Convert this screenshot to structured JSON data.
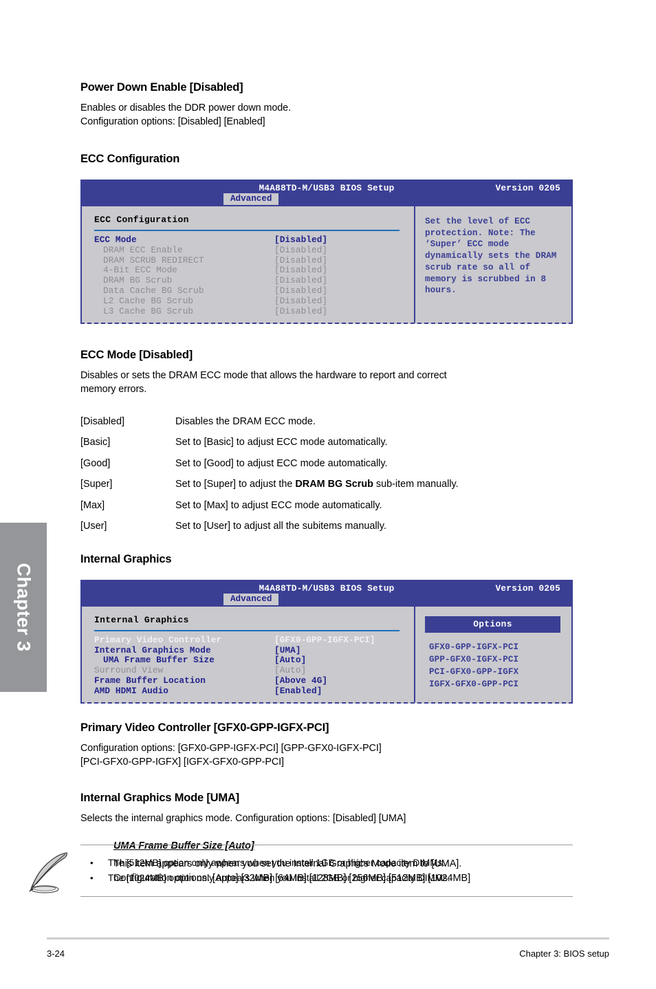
{
  "chapter_tab": {
    "label": "Chapter 3"
  },
  "sections": {
    "power_down": {
      "heading": "Power Down Enable [Disabled]",
      "line1": "Enables or disables the DDR power down mode.",
      "line2": "Configuration options: [Disabled] [Enabled]"
    },
    "ecc_config_heading": "ECC Configuration",
    "ecc_mode": {
      "heading": "ECC Mode [Disabled]",
      "desc_line1": "Disables or sets the DRAM ECC mode that allows the hardware to report and correct",
      "desc_line2": "memory errors.",
      "options": [
        {
          "key": "[Disabled]",
          "pre": "Disables the DRAM ECC mode.",
          "bold": "",
          "post": ""
        },
        {
          "key": "[Basic]",
          "pre": "Set to [Basic] to adjust ECC mode automatically.",
          "bold": "",
          "post": ""
        },
        {
          "key": "[Good]",
          "pre": "Set to [Good] to adjust ECC mode automatically.",
          "bold": "",
          "post": ""
        },
        {
          "key": "[Super]",
          "pre": "Set to [Super] to adjust the ",
          "bold": "DRAM BG Scrub",
          "post": " sub-item manually."
        },
        {
          "key": "[Max]",
          "pre": "Set to [Max] to adjust ECC mode automatically.",
          "bold": "",
          "post": ""
        },
        {
          "key": "[User]",
          "pre": "Set to [User] to adjust all the subitems manually.",
          "bold": "",
          "post": ""
        }
      ]
    },
    "internal_graphics_heading": "Internal Graphics",
    "primary_video": {
      "heading": "Primary Video Controller [GFX0-GPP-IGFX-PCI]",
      "line1": "Configuration options: [GFX0-GPP-IGFX-PCI] [GPP-GFX0-IGFX-PCI]",
      "line2": "[PCI-GFX0-GPP-IGFX] [IGFX-GFX0-GPP-PCI]"
    },
    "internal_graphics_mode": {
      "heading": "Internal Graphics Mode [UMA]",
      "line1": "Selects the internal graphics mode. Configuration options: [Disabled] [UMA]",
      "sub_title": "UMA Frame Buffer Size [Auto]",
      "sub_line1": "This item appears only when you set the Internal Graphics Mode item to [UMA].",
      "sub_line2": "Configuration options: [Auto] [32MB] [64MB] [128MB] [256MB] [512MB] [1024MB]"
    }
  },
  "bios_screen_1": {
    "title": "M4A88TD-M/USB3 BIOS Setup",
    "version": "Version 0205",
    "tab": "Advanced",
    "section_title": "ECC Configuration",
    "rows": [
      {
        "name": "ECC Mode",
        "value": "[Disabled]",
        "state": "normal",
        "indent": 0
      },
      {
        "name": "DRAM ECC Enable",
        "value": "[Disabled]",
        "state": "dim",
        "indent": 1
      },
      {
        "name": "DRAM SCRUB REDIRECT",
        "value": "[Disabled]",
        "state": "dim",
        "indent": 1
      },
      {
        "name": "4-Bit ECC Mode",
        "value": "[Disabled]",
        "state": "dim",
        "indent": 1
      },
      {
        "name": "DRAM BG Scrub",
        "value": "[Disabled]",
        "state": "dim",
        "indent": 1
      },
      {
        "name": "Data Cache BG Scrub",
        "value": "[Disabled]",
        "state": "dim",
        "indent": 1
      },
      {
        "name": "L2 Cache BG Scrub",
        "value": "[Disabled]",
        "state": "dim",
        "indent": 1
      },
      {
        "name": "L3 Cache BG Scrub",
        "value": "[Disabled]",
        "state": "dim",
        "indent": 1
      }
    ],
    "help_text": "Set the level of ECC protection. Note: The ‘Super’ ECC mode dynamically sets the DRAM scrub rate so all of memory is scrubbed in 8 hours."
  },
  "bios_screen_2": {
    "title": "M4A88TD-M/USB3 BIOS Setup",
    "version": "Version 0205",
    "tab": "Advanced",
    "section_title": "Internal Graphics",
    "rows": [
      {
        "name": "Primary Video Controller",
        "value": "[GFX0-GPP-IGFX-PCI]",
        "state": "sel",
        "indent": 0
      },
      {
        "name": "Internal Graphics Mode",
        "value": "[UMA]",
        "state": "normal",
        "indent": 0
      },
      {
        "name": "UMA Frame Buffer Size",
        "value": "[Auto]",
        "state": "normal",
        "indent": 1
      },
      {
        "name": "Surround View",
        "value": "[Auto]",
        "state": "dim",
        "indent": 0
      },
      {
        "name": "Frame Buffer Location",
        "value": "[Above 4G]",
        "state": "normal",
        "indent": 0
      },
      {
        "name": "AMD HDMI Audio",
        "value": "[Enabled]",
        "state": "normal",
        "indent": 0
      }
    ],
    "options_header": "Options",
    "options": [
      "GFX0-GPP-IGFX-PCI",
      "GPP-GFX0-IGFX-PCI",
      "PCI-GFX0-GPP-IGFX",
      "IGFX-GFX0-GPP-PCI"
    ]
  },
  "note": {
    "icon": "quill-pen-icon",
    "bullet": "•",
    "items": [
      "The [512MB] option only appears when you install 1GB or higher capacity DIMMs.",
      "The [1024MB] option only appears when you install 2GB or higher capacity DIMMs."
    ]
  },
  "footer": {
    "page_number": "3-24",
    "chapter_label": "Chapter 3: BIOS setup"
  },
  "colors": {
    "bios_blue": "#3b3f94",
    "bios_body": "#c9c9ce",
    "rule_blue": "#1d6fb8",
    "tab_gray": "#949699"
  }
}
